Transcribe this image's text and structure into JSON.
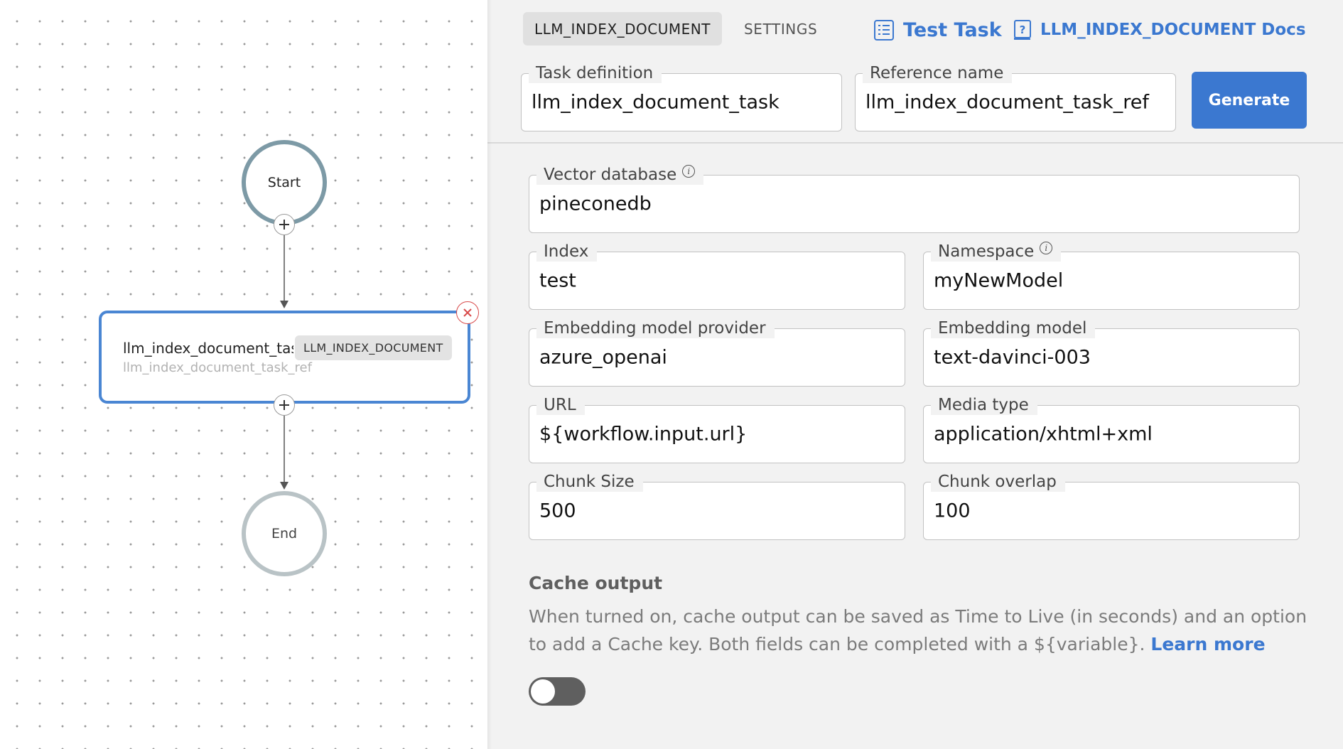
{
  "canvas": {
    "start_label": "Start",
    "end_label": "End",
    "task_node": {
      "name": "llm_index_document_task",
      "ref": "llm_index_document_task_ref",
      "type_badge": "LLM_INDEX_DOCUMENT"
    }
  },
  "header": {
    "tabs": [
      {
        "label": "LLM_INDEX_DOCUMENT",
        "active": true
      },
      {
        "label": "SETTINGS",
        "active": false
      }
    ],
    "test_task_label": "Test Task",
    "docs_label": "LLM_INDEX_DOCUMENT Docs",
    "task_definition": {
      "label": "Task definition",
      "value": "llm_index_document_task"
    },
    "reference_name": {
      "label": "Reference name",
      "value": "llm_index_document_task_ref"
    },
    "generate_label": "Generate"
  },
  "form": {
    "vector_database": {
      "label": "Vector database",
      "value": "pineconedb"
    },
    "index": {
      "label": "Index",
      "value": "test"
    },
    "namespace": {
      "label": "Namespace",
      "value": "myNewModel"
    },
    "embedding_model_provider": {
      "label": "Embedding model provider",
      "value": "azure_openai"
    },
    "embedding_model": {
      "label": "Embedding model",
      "value": "text-davinci-003"
    },
    "url": {
      "label": "URL",
      "value": "${workflow.input.url}"
    },
    "media_type": {
      "label": "Media type",
      "value": "application/xhtml+xml"
    },
    "chunk_size": {
      "label": "Chunk Size",
      "value": "500"
    },
    "chunk_overlap": {
      "label": "Chunk overlap",
      "value": "100"
    }
  },
  "cache": {
    "title": "Cache output",
    "description": "When turned on, cache output can be saved as Time to Live (in seconds) and an option to add a Cache key. Both fields can be completed with a ${variable}.",
    "learn_more": "Learn more",
    "enabled": false
  },
  "colors": {
    "accent": "#3b78d0",
    "panel_bg": "#f2f2f2",
    "selected_node_border": "#4a86d3",
    "toggle_off": "#5f5f5f"
  }
}
